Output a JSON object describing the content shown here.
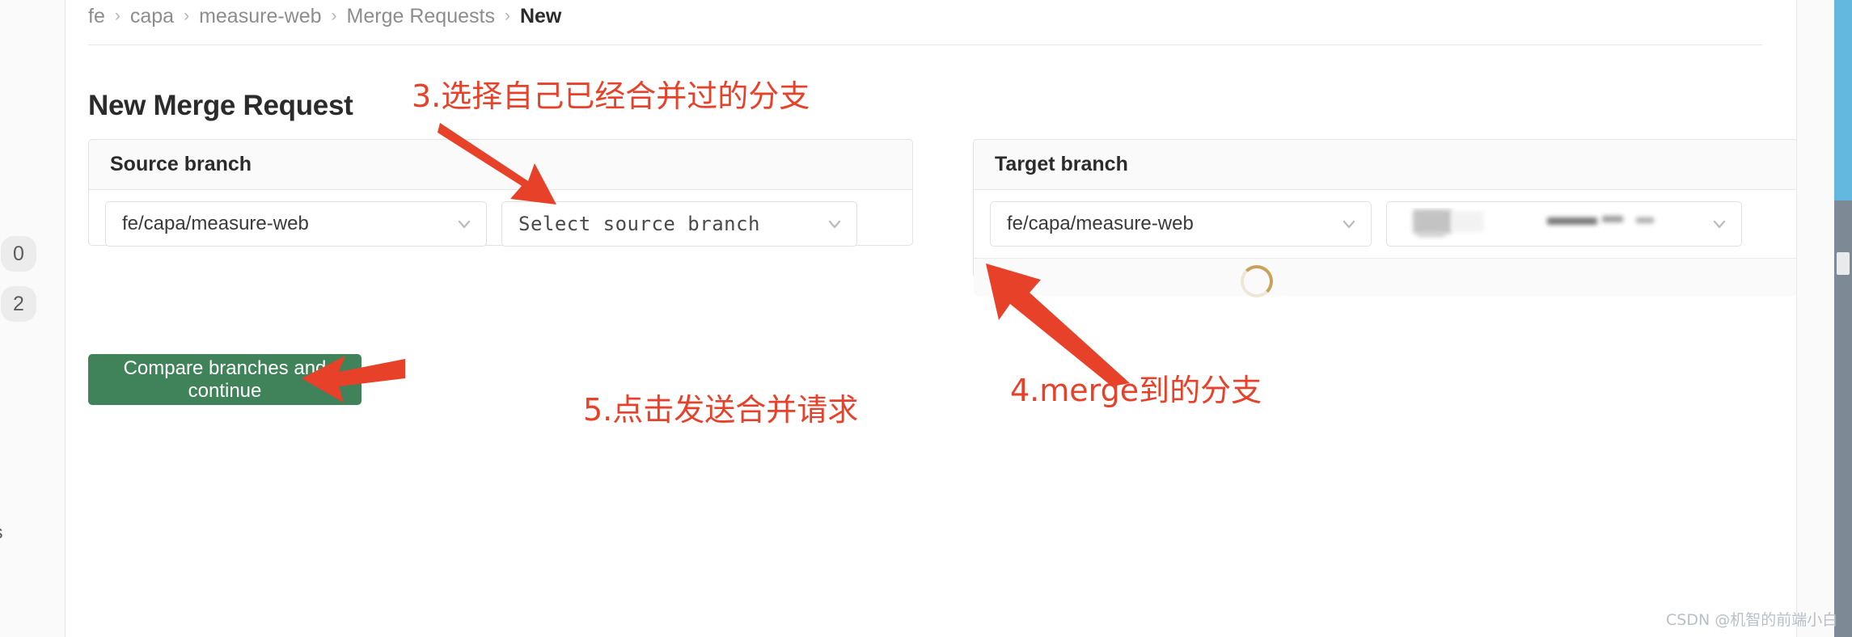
{
  "colors": {
    "annotation_red": "#e8412a",
    "primary_green": "#40825a",
    "spinner": "#c9a15a",
    "badge_bg": "#ececec",
    "panel_header_bg": "#fafafa",
    "right_strip_blue": "#63b8e0"
  },
  "left_rail": {
    "badges": [
      "0",
      "2"
    ],
    "clipped_label": "s"
  },
  "breadcrumb": {
    "separator": "›",
    "items": [
      {
        "label": "fe",
        "current": false
      },
      {
        "label": "capa",
        "current": false
      },
      {
        "label": "measure-web",
        "current": false
      },
      {
        "label": "Merge Requests",
        "current": false
      },
      {
        "label": "New",
        "current": true
      }
    ]
  },
  "page": {
    "title": "New Merge Request"
  },
  "source_panel": {
    "header": "Source branch",
    "project_dropdown": {
      "value": "fe/capa/measure-web",
      "icon": "chevron-down-icon"
    },
    "branch_dropdown": {
      "value": "Select source branch",
      "icon": "chevron-down-icon"
    }
  },
  "target_panel": {
    "header": "Target branch",
    "project_dropdown": {
      "value": "fe/capa/measure-web",
      "icon": "chevron-down-icon"
    },
    "branch_dropdown": {
      "value": "",
      "redacted": true,
      "icon": "chevron-down-icon"
    },
    "loading_spinner": "loading-spinner-icon"
  },
  "actions": {
    "compare_button": "Compare branches and continue"
  },
  "annotations": [
    {
      "id": "anno-3",
      "text": "3.选择自己已经合并过的分支"
    },
    {
      "id": "anno-4",
      "text": "4.merge到的分支"
    },
    {
      "id": "anno-5",
      "text": "5.点击发送合并请求"
    }
  ],
  "annotation_text": {
    "three": "3.选择自己已经合并过的分支",
    "four": "4.merge到的分支",
    "five": "5.点击发送合并请求"
  },
  "watermark": "CSDN @机智的前端小白"
}
